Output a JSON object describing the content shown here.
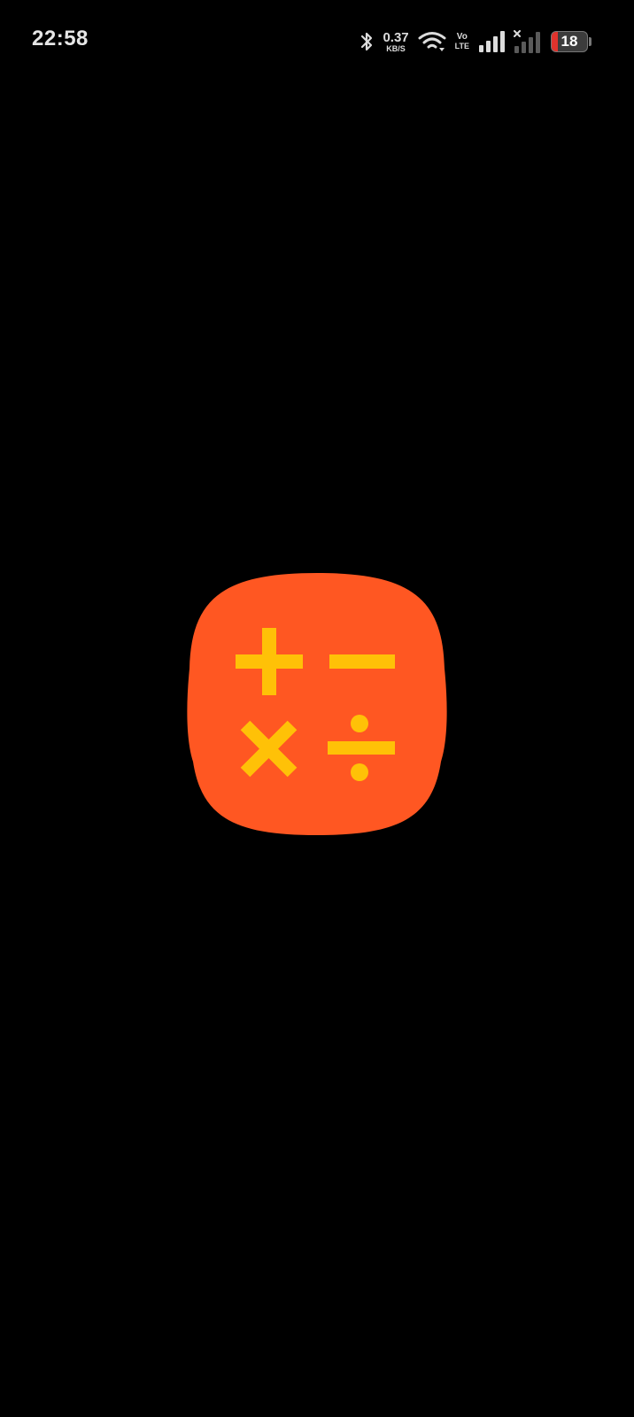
{
  "status_bar": {
    "time": "22:58",
    "network_speed_value": "0.37",
    "network_speed_unit": "KB/S",
    "volte_top": "Vo",
    "volte_bottom": "LTE",
    "battery_level": "18",
    "battery_fraction": 0.18,
    "icons": [
      "bluetooth-icon",
      "wifi-icon",
      "signal-strength-icon",
      "no-signal-icon",
      "battery-icon"
    ]
  },
  "splash": {
    "logo_icon": "calculator-app-icon",
    "colors": {
      "background": "#000000",
      "logo_background": "#FF5722",
      "logo_symbols": "#FFC107"
    }
  }
}
